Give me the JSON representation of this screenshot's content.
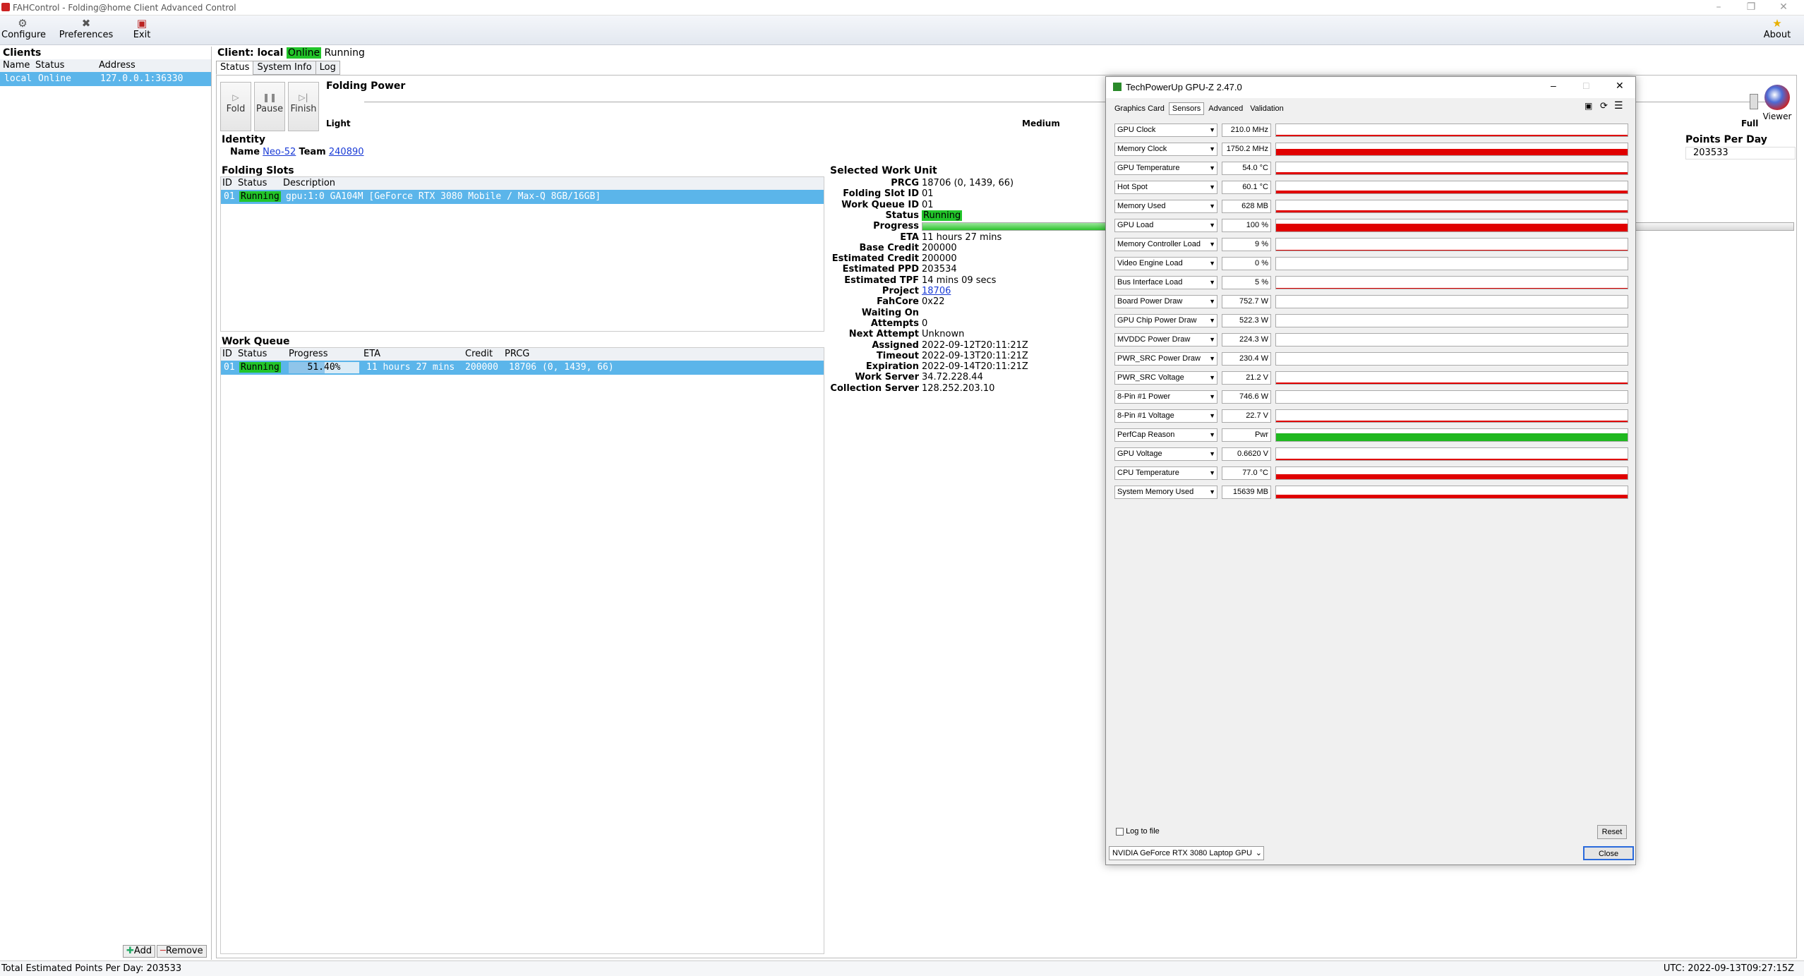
{
  "window": {
    "title": "FAHControl - Folding@home Client Advanced Control"
  },
  "toolbar": {
    "configure": "Configure",
    "preferences": "Preferences",
    "exit": "Exit",
    "about": "About",
    "viewer": "Viewer"
  },
  "clients": {
    "title": "Clients",
    "headers": [
      "Name",
      "Status",
      "Address"
    ],
    "row": {
      "name": "local",
      "status": "Online",
      "address": "127.0.0.1:36330"
    },
    "add": "Add",
    "remove": "Remove"
  },
  "client": {
    "label": "Client: local",
    "online": "Online",
    "state": "Running",
    "tabs": [
      "Status",
      "System Info",
      "Log"
    ],
    "buttons": {
      "fold": "Fold",
      "pause": "Pause",
      "finish": "Finish"
    },
    "folding_power": {
      "title": "Folding Power",
      "light": "Light",
      "medium": "Medium",
      "full": "Full",
      "level": 1.0
    },
    "identity": {
      "title": "Identity",
      "name_label": "Name",
      "name": "Neo-52",
      "team_label": "Team",
      "team": "240890"
    },
    "ppd": {
      "title": "Points Per Day",
      "value": "203533"
    }
  },
  "slots": {
    "title": "Folding Slots",
    "headers": [
      "ID",
      "Status",
      "Description"
    ],
    "row": {
      "id": "01",
      "status": "Running",
      "desc": "gpu:1:0 GA104M [GeForce RTX 3080 Mobile / Max-Q 8GB/16GB]"
    }
  },
  "queue": {
    "title": "Work Queue",
    "headers": [
      "ID",
      "Status",
      "Progress",
      "ETA",
      "Credit",
      "PRCG"
    ],
    "row": {
      "id": "01",
      "status": "Running",
      "progress": "51.40%",
      "progress_value": 0.514,
      "eta": "11 hours 27 mins",
      "credit": "200000",
      "prcg": "18706 (0, 1439, 66)"
    }
  },
  "work_unit": {
    "title": "Selected Work Unit",
    "labels": [
      "PRCG",
      "Folding Slot ID",
      "Work Queue ID",
      "Status",
      "Progress",
      "ETA",
      "Base Credit",
      "Estimated Credit",
      "Estimated PPD",
      "Estimated TPF",
      "Project",
      "FahCore",
      "Waiting On",
      "Attempts",
      "Next Attempt",
      "Assigned",
      "Timeout",
      "Expiration",
      "Work Server",
      "Collection Server"
    ],
    "values": [
      "18706 (0, 1439, 66)",
      "01",
      "01",
      "Running",
      "",
      "11 hours 27 mins",
      "200000",
      "200000",
      "203534",
      "14 mins 09 secs",
      "18706",
      "0x22",
      "",
      "0",
      "Unknown",
      "2022-09-12T20:11:21Z",
      "2022-09-13T20:11:21Z",
      "2022-09-14T20:11:21Z",
      "34.72.228.44",
      "128.252.203.10"
    ],
    "progress_value": 0.514
  },
  "statusbar": {
    "left": "Total Estimated Points Per Day: 203533",
    "right": "UTC: 2022-09-13T09:27:15Z"
  },
  "gpuz": {
    "title": "TechPowerUp GPU-Z 2.47.0",
    "tabs": [
      "Graphics Card",
      "Sensors",
      "Advanced",
      "Validation"
    ],
    "sensors": [
      {
        "name": "GPU Clock",
        "value": "210.0 MHz",
        "level": 0.1,
        "color": "#e00000"
      },
      {
        "name": "Memory Clock",
        "value": "1750.2 MHz",
        "level": 0.55,
        "color": "#e00000"
      },
      {
        "name": "GPU Temperature",
        "value": "54.0 °C",
        "level": 0.2,
        "color": "#e00000"
      },
      {
        "name": "Hot Spot",
        "value": "60.1 °C",
        "level": 0.25,
        "color": "#e00000"
      },
      {
        "name": "Memory Used",
        "value": "628 MB",
        "level": 0.15,
        "color": "#e00000"
      },
      {
        "name": "GPU Load",
        "value": "100 %",
        "level": 0.62,
        "color": "#e00000"
      },
      {
        "name": "Memory Controller Load",
        "value": "9 %",
        "level": 0.05,
        "color": "#e00000"
      },
      {
        "name": "Video Engine Load",
        "value": "0 %",
        "level": 0,
        "color": "#e00000"
      },
      {
        "name": "Bus Interface Load",
        "value": "5 %",
        "level": 0.04,
        "color": "#e00000"
      },
      {
        "name": "Board Power Draw",
        "value": "752.7 W",
        "level": 0,
        "color": "#e00000"
      },
      {
        "name": "GPU Chip Power Draw",
        "value": "522.3 W",
        "level": 0,
        "color": "#e00000"
      },
      {
        "name": "MVDDC Power Draw",
        "value": "224.3 W",
        "level": 0,
        "color": "#e00000"
      },
      {
        "name": "PWR_SRC Power Draw",
        "value": "230.4 W",
        "level": 0,
        "color": "#e00000"
      },
      {
        "name": "PWR_SRC Voltage",
        "value": "21.2 V",
        "level": 0.1,
        "color": "#e00000"
      },
      {
        "name": "8-Pin #1 Power",
        "value": "746.6 W",
        "level": 0,
        "color": "#e00000"
      },
      {
        "name": "8-Pin #1 Voltage",
        "value": "22.7 V",
        "level": 0.1,
        "color": "#e00000"
      },
      {
        "name": "PerfCap Reason",
        "value": "Pwr",
        "level": 0.62,
        "color": "#1fb81f"
      },
      {
        "name": "GPU Voltage",
        "value": "0.6620 V",
        "level": 0.12,
        "color": "#e00000"
      },
      {
        "name": "CPU Temperature",
        "value": "77.0 °C",
        "level": 0.4,
        "color": "#e00000"
      },
      {
        "name": "System Memory Used",
        "value": "15639 MB",
        "level": 0.3,
        "color": "#e00000"
      }
    ],
    "log_to_file": "Log to file",
    "reset": "Reset",
    "device": "NVIDIA GeForce RTX 3080 Laptop GPU",
    "close": "Close"
  }
}
